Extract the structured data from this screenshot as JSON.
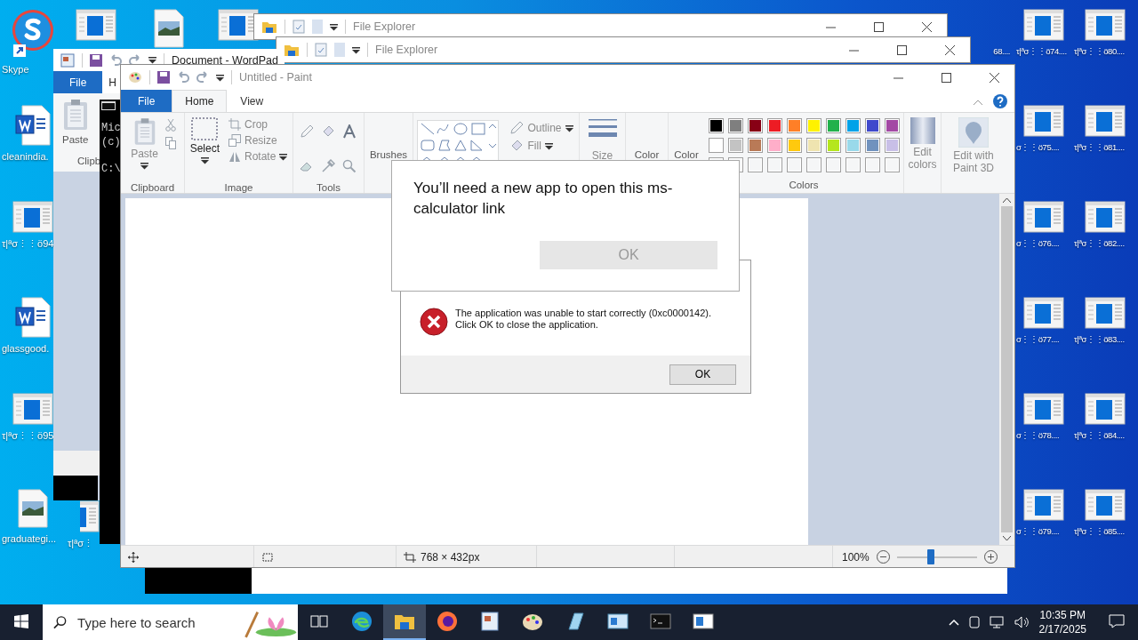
{
  "desktop": {
    "icons": [
      {
        "kind": "skype",
        "label": "Skype"
      },
      {
        "kind": "word",
        "label": "cleanindia."
      },
      {
        "kind": "doc",
        "label": "τ|ªσ⋮⋮ö94"
      },
      {
        "kind": "word",
        "label": "glassgood."
      },
      {
        "kind": "doc",
        "label": "τ|ªσ⋮⋮ö95"
      },
      {
        "kind": "image",
        "label": "graduategi..."
      },
      {
        "kind": "doc"
      },
      {
        "kind": "doc",
        "label": "τ|ªσ⋮"
      },
      {
        "kind": "image"
      },
      {
        "kind": "doc"
      },
      {
        "kind": "doc",
        "label": "68...."
      },
      {
        "kind": "doc",
        "label": "τ|ªσ⋮⋮ö74...."
      },
      {
        "kind": "doc",
        "label": "σ⋮⋮ö75...."
      },
      {
        "kind": "doc",
        "label": "σ⋮⋮ö76...."
      },
      {
        "kind": "doc",
        "label": "σ⋮⋮ö77...."
      },
      {
        "kind": "doc",
        "label": "σ⋮⋮ö78...."
      },
      {
        "kind": "doc",
        "label": "σ⋮⋮ö79...."
      },
      {
        "kind": "doc",
        "label": "τ|ªσ⋮⋮ö80...."
      },
      {
        "kind": "doc",
        "label": "τ|ªσ⋮⋮ö81...."
      },
      {
        "kind": "doc",
        "label": "τ|ªσ⋮⋮ö82...."
      },
      {
        "kind": "doc",
        "label": "τ|ªσ⋮⋮ö83...."
      },
      {
        "kind": "doc",
        "label": "τ|ªσ⋮⋮ö84...."
      },
      {
        "kind": "doc",
        "label": "τ|ªσ⋮⋮ö85...."
      }
    ]
  },
  "explorer_windows": [
    {
      "title": "File Explorer"
    },
    {
      "title": "File Explorer"
    }
  ],
  "wordpad": {
    "title": "Document - WordPad",
    "tabs": [
      {
        "label": "File",
        "kind": "file"
      },
      {
        "label": "H",
        "kind": "tab"
      }
    ],
    "paste": "Paste",
    "group": "Clipb"
  },
  "console": {
    "lines": [
      "Mic",
      "(c)",
      "C:\\"
    ]
  },
  "paint": {
    "title": "Untitled - Paint",
    "tabs": [
      {
        "label": "File",
        "kind": "file"
      },
      {
        "label": "Home",
        "kind": "tab",
        "selected": true
      },
      {
        "label": "View",
        "kind": "tab",
        "selected": false
      }
    ],
    "clipboard": {
      "paste": "Paste",
      "label": "Clipboard"
    },
    "image": {
      "select": "Select",
      "crop": "Crop",
      "resize": "Resize",
      "rotate": "Rotate",
      "label": "Image"
    },
    "tools": {
      "label": "Tools"
    },
    "brushes": "Brushes",
    "shapes": {
      "outline": "Outline",
      "fill": "Fill"
    },
    "size": "Size",
    "color_1": "Color",
    "color_2": "Color",
    "colors": {
      "label": "Colors",
      "edit": "Edit colors",
      "swatches": [
        {
          "kind": "color",
          "color": "#000000"
        },
        {
          "kind": "color",
          "color": "#7f7f7f"
        },
        {
          "kind": "color",
          "color": "#880015"
        },
        {
          "kind": "color",
          "color": "#ed1c24"
        },
        {
          "kind": "color",
          "color": "#ff7f27"
        },
        {
          "kind": "color",
          "color": "#fff200"
        },
        {
          "kind": "color",
          "color": "#22b14c"
        },
        {
          "kind": "color",
          "color": "#00a2e8"
        },
        {
          "kind": "color",
          "color": "#3f48cc"
        },
        {
          "kind": "color",
          "color": "#a349a4"
        },
        {
          "kind": "color",
          "color": "#ffffff"
        },
        {
          "kind": "color",
          "color": "#c3c3c3"
        },
        {
          "kind": "color",
          "color": "#b97a57"
        },
        {
          "kind": "color",
          "color": "#ffaec9"
        },
        {
          "kind": "color",
          "color": "#ffc90e"
        },
        {
          "kind": "color",
          "color": "#efe4b0"
        },
        {
          "kind": "color",
          "color": "#b5e61d"
        },
        {
          "kind": "color",
          "color": "#99d9ea"
        },
        {
          "kind": "color",
          "color": "#7092be"
        },
        {
          "kind": "color",
          "color": "#c8bfe7"
        },
        {
          "kind": "empty"
        },
        {
          "kind": "empty"
        },
        {
          "kind": "empty"
        },
        {
          "kind": "empty"
        },
        {
          "kind": "empty"
        },
        {
          "kind": "empty"
        },
        {
          "kind": "empty"
        },
        {
          "kind": "empty"
        },
        {
          "kind": "empty"
        },
        {
          "kind": "empty"
        }
      ]
    },
    "paint3d": "Edit with Paint 3D",
    "status": {
      "dimensions": "768 × 432px",
      "zoom": "100%",
      "level": 0.42
    }
  },
  "app_dialog": {
    "message": "You’ll need a new app to open this ms-calculator link",
    "button": {
      "label": "OK",
      "disabled": true
    }
  },
  "error_dialog": {
    "message": "The application was unable to start correctly (0xc0000142). Click OK to close the application.",
    "button": {
      "label": "OK",
      "disabled": false
    }
  },
  "taskbar": {
    "search": {
      "placeholder": "Type here to search"
    },
    "apps": [
      {
        "kind": "taskview",
        "selected": false
      },
      {
        "kind": "edge",
        "selected": false
      },
      {
        "kind": "explorer",
        "selected": true
      },
      {
        "kind": "firefox",
        "selected": false
      },
      {
        "kind": "wordpad",
        "selected": false
      },
      {
        "kind": "paint",
        "selected": false
      },
      {
        "kind": "notepad",
        "selected": false
      },
      {
        "kind": "control",
        "selected": false
      },
      {
        "kind": "console",
        "selected": false
      },
      {
        "kind": "window",
        "selected": false
      }
    ],
    "time": "10:35 PM",
    "date": "2/17/2025"
  }
}
